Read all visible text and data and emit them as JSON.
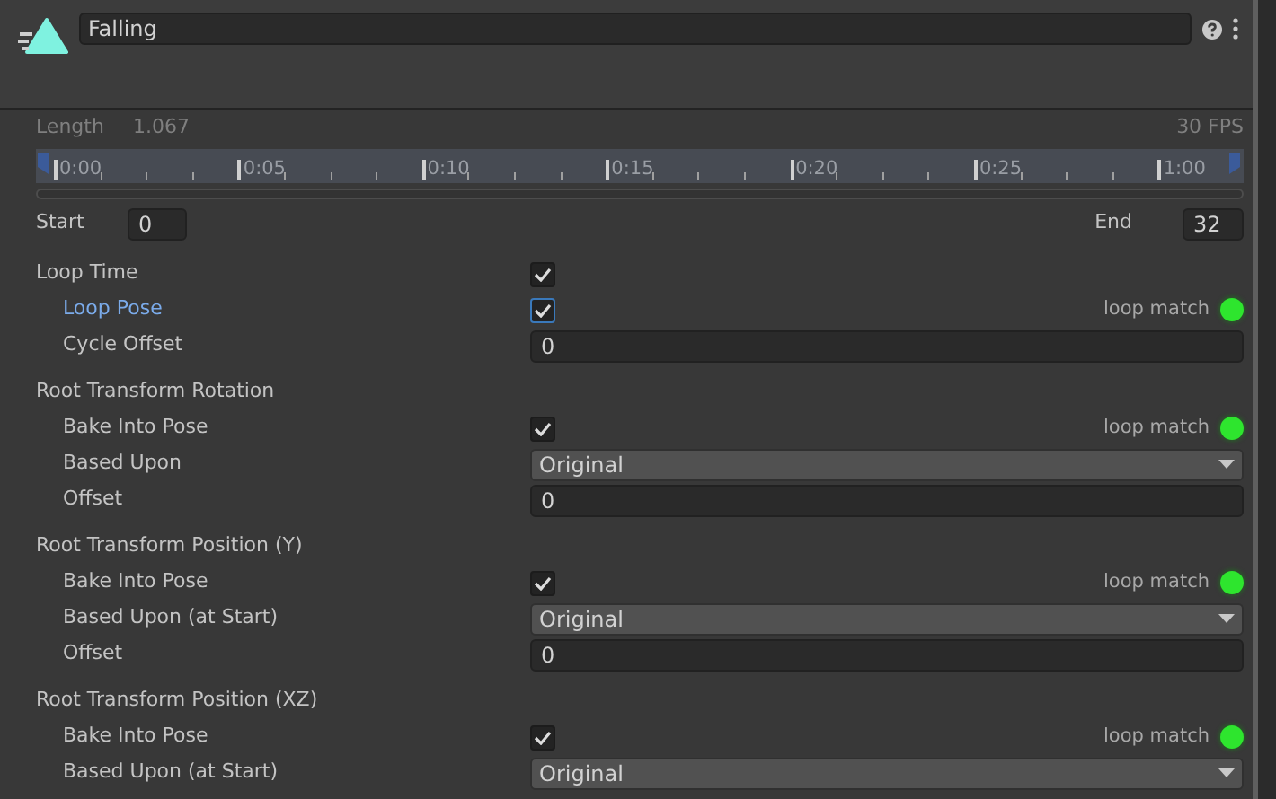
{
  "clip": {
    "name": "Falling"
  },
  "timing": {
    "length_label": "Length",
    "length": "1.067",
    "fps": "30 FPS"
  },
  "timeline": {
    "ticks": [
      "0:00",
      "0:05",
      "0:10",
      "0:15",
      "0:20",
      "0:25",
      "1:00"
    ]
  },
  "range": {
    "start_label": "Start",
    "start": "0",
    "end_label": "End",
    "end": "32"
  },
  "sections": [
    {
      "label": "Loop Time",
      "kind": "checkbox",
      "checked": true,
      "children": [
        {
          "label": "Loop Pose",
          "kind": "checkbox",
          "checked": true,
          "focused": true,
          "loop_match": {
            "text": "loop match",
            "matched": true
          }
        },
        {
          "label": "Cycle Offset",
          "kind": "number",
          "value": "0"
        }
      ]
    },
    {
      "label": "Root Transform Rotation",
      "kind": "heading",
      "children": [
        {
          "label": "Bake Into Pose",
          "kind": "checkbox",
          "checked": true,
          "focused": false,
          "loop_match": {
            "text": "loop match",
            "matched": true
          }
        },
        {
          "label": "Based Upon",
          "kind": "dropdown",
          "value": "Original"
        },
        {
          "label": "Offset",
          "kind": "number",
          "value": "0"
        }
      ]
    },
    {
      "label": "Root Transform Position (Y)",
      "kind": "heading",
      "children": [
        {
          "label": "Bake Into Pose",
          "kind": "checkbox",
          "checked": true,
          "focused": false,
          "loop_match": {
            "text": "loop match",
            "matched": true
          }
        },
        {
          "label": "Based Upon (at Start)",
          "kind": "dropdown",
          "value": "Original"
        },
        {
          "label": "Offset",
          "kind": "number",
          "value": "0"
        }
      ]
    },
    {
      "label": "Root Transform Position (XZ)",
      "kind": "heading",
      "children": [
        {
          "label": "Bake Into Pose",
          "kind": "checkbox",
          "checked": true,
          "focused": false,
          "loop_match": {
            "text": "loop match",
            "matched": true
          }
        },
        {
          "label": "Based Upon (at Start)",
          "kind": "dropdown",
          "value": "Original"
        }
      ]
    }
  ]
}
